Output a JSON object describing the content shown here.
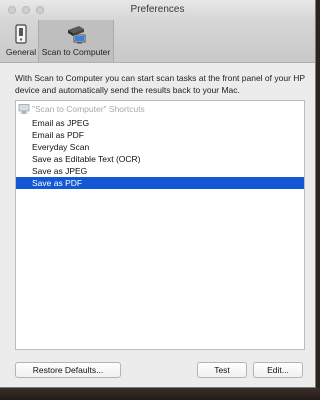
{
  "window": {
    "title": "Preferences"
  },
  "toolbar": {
    "tabs": [
      {
        "label": "General",
        "icon": "switch-icon"
      },
      {
        "label": "Scan to Computer",
        "icon": "scanner-computer-icon",
        "selected": true
      }
    ]
  },
  "description": "With Scan to Computer you can start scan tasks at the front panel of your HP device and automatically send the results back to your Mac.",
  "shortcuts": {
    "header": "\"Scan to Computer\" Shortcuts",
    "items": [
      {
        "label": "Email as JPEG"
      },
      {
        "label": "Email as PDF"
      },
      {
        "label": "Everyday Scan"
      },
      {
        "label": "Save as Editable Text (OCR)"
      },
      {
        "label": "Save as JPEG"
      },
      {
        "label": "Save as PDF",
        "selected": true
      }
    ]
  },
  "buttons": {
    "restore_defaults": "Restore Defaults...",
    "test": "Test",
    "edit": "Edit..."
  },
  "colors": {
    "selection": "#1257d4",
    "window_bg": "#ececec"
  }
}
